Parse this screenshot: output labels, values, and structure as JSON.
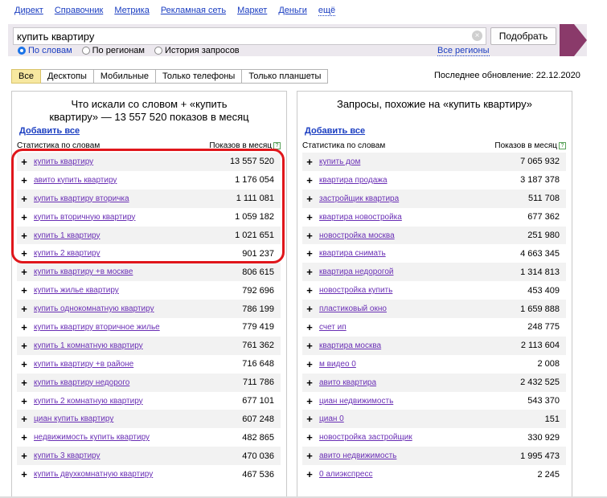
{
  "nav": {
    "items": [
      "Директ",
      "Справочник",
      "Метрика",
      "Рекламная сеть",
      "Маркет",
      "Деньги"
    ],
    "more": "ещё"
  },
  "search": {
    "value": "купить квартиру",
    "button": "Подобрать",
    "radios": [
      "По словам",
      "По регионам",
      "История запросов"
    ],
    "selected_radio": "По словам",
    "all_regions": "Все регионы"
  },
  "tabs": [
    "Все",
    "Десктопы",
    "Мобильные",
    "Только телефоны",
    "Только планшеты"
  ],
  "last_update": "Последнее обновление: 22.12.2020",
  "left": {
    "title_line1": "Что искали со словом + «купить",
    "title_line2": "квартиру» — 13 557 520 показов в месяц",
    "add_all": "Добавить все",
    "col_keyword": "Статистика по словам",
    "col_count": "Показов в месяц",
    "rows": [
      {
        "kw": "купить квартиру",
        "n": "13 557 520"
      },
      {
        "kw": "авито купить квартиру",
        "n": "1 176 054"
      },
      {
        "kw": "купить квартиру вторичка",
        "n": "1 111 081"
      },
      {
        "kw": "купить вторичную квартиру",
        "n": "1 059 182"
      },
      {
        "kw": "купить 1 квартиру",
        "n": "1 021 651"
      },
      {
        "kw": "купить 2 квартиру",
        "n": "901 237"
      },
      {
        "kw": "купить квартиру +в москве",
        "n": "806 615"
      },
      {
        "kw": "купить жилье квартиру",
        "n": "792 696"
      },
      {
        "kw": "купить однокомнатную квартиру",
        "n": "786 199"
      },
      {
        "kw": "купить квартиру вторичное жилье",
        "n": "779 419"
      },
      {
        "kw": "купить 1 комнатную квартиру",
        "n": "761 362"
      },
      {
        "kw": "купить квартиру +в районе",
        "n": "716 648"
      },
      {
        "kw": "купить квартиру недорого",
        "n": "711 786"
      },
      {
        "kw": "купить 2 комнатную квартиру",
        "n": "677 101"
      },
      {
        "kw": "циан купить квартиру",
        "n": "607 248"
      },
      {
        "kw": "недвижимость купить квартиру",
        "n": "482 865"
      },
      {
        "kw": "купить 3 квартиру",
        "n": "470 036"
      },
      {
        "kw": "купить двухкомнатную квартиру",
        "n": "467 536"
      }
    ]
  },
  "right": {
    "title": "Запросы, похожие на «купить квартиру»",
    "add_all": "Добавить все",
    "col_keyword": "Статистика по словам",
    "col_count": "Показов в месяц",
    "rows": [
      {
        "kw": "купить дом",
        "n": "7 065 932"
      },
      {
        "kw": "квартира продажа",
        "n": "3 187 378"
      },
      {
        "kw": "застройщик квартира",
        "n": "511 708"
      },
      {
        "kw": "квартира новостройка",
        "n": "677 362"
      },
      {
        "kw": "новостройка москва",
        "n": "251 980"
      },
      {
        "kw": "квартира снимать",
        "n": "4 663 345"
      },
      {
        "kw": "квартира недорогой",
        "n": "1 314 813"
      },
      {
        "kw": "новостройка купить",
        "n": "453 409"
      },
      {
        "kw": "пластиковый окно",
        "n": "1 659 888"
      },
      {
        "kw": "счет ип",
        "n": "248 775"
      },
      {
        "kw": "квартира москва",
        "n": "2 113 604"
      },
      {
        "kw": "м видео 0",
        "n": "2 008"
      },
      {
        "kw": "авито квартира",
        "n": "2 432 525"
      },
      {
        "kw": "циан недвижимость",
        "n": "543 370"
      },
      {
        "kw": "циан 0",
        "n": "151"
      },
      {
        "kw": "новостройка застройщик",
        "n": "330 929"
      },
      {
        "kw": "авито недвижимость",
        "n": "1 995 473"
      },
      {
        "kw": "0 алиэкспресс",
        "n": "2 245"
      }
    ]
  },
  "help_glyph": "?",
  "plus_glyph": "+",
  "clear_glyph": "×",
  "colors": {
    "accent": "#8a3a6a",
    "link": "#1a3dc1",
    "visited": "#6a2fb5",
    "highlight": "#e0161b",
    "active_tab": "#f7e8a0"
  }
}
